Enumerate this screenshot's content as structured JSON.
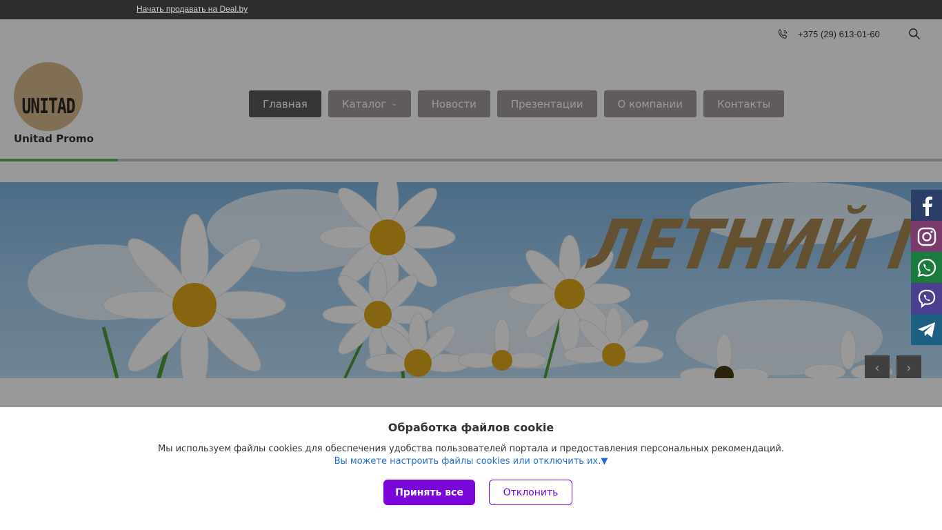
{
  "topbar": {
    "sell_link": "Начать продавать на Deal.by"
  },
  "header": {
    "phone": "+375 (29) 613-01-60",
    "logo_text": "UNITAD",
    "brand_name": "Unitad Promo",
    "progress_fraction": 0.125
  },
  "nav": {
    "items": [
      {
        "label": "Главная"
      },
      {
        "label": "Каталог",
        "chevron": "⌄"
      },
      {
        "label": "Новости"
      },
      {
        "label": "Презентации"
      },
      {
        "label": "О компании"
      },
      {
        "label": "Контакты"
      }
    ]
  },
  "banner": {
    "title": "ЛЕТНИЙ МЕРЧ!",
    "prev": "‹",
    "next": "›"
  },
  "social": [
    {
      "icon": "facebook-icon",
      "color": "#3b5998"
    },
    {
      "icon": "instagram-icon",
      "color": "#c13584"
    },
    {
      "icon": "whatsapp-icon",
      "color": "#25d366"
    },
    {
      "icon": "viber-icon",
      "color": "#7360f2"
    },
    {
      "icon": "telegram-icon",
      "color": "#2ca5e0"
    }
  ],
  "cookie": {
    "title": "Обработка файлов cookie",
    "description": "Мы используем файлы cookies для обеспечения удобства пользователей портала и предоставления персональных рекомендаций.",
    "settings_link": "Вы можете настроить файлы cookies или отключить их.▼",
    "accept_label": "Принять все",
    "decline_label": "Отклонить"
  },
  "colors": {
    "accent": "#7a06d9",
    "nav_active": "#5d5a5a",
    "progress": "#5cb85c"
  }
}
